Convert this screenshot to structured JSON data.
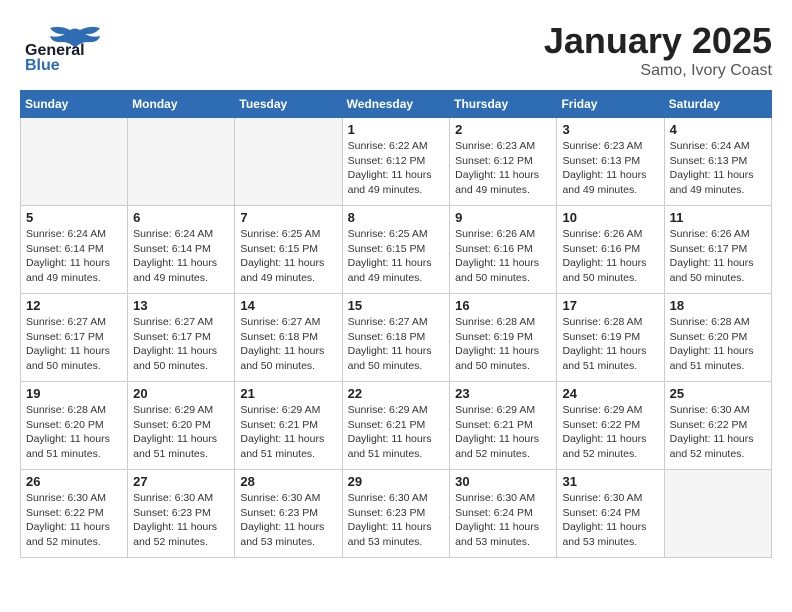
{
  "header": {
    "logo_general": "General",
    "logo_blue": "Blue",
    "month": "January 2025",
    "location": "Samo, Ivory Coast"
  },
  "days_of_week": [
    "Sunday",
    "Monday",
    "Tuesday",
    "Wednesday",
    "Thursday",
    "Friday",
    "Saturday"
  ],
  "weeks": [
    [
      {
        "day": "",
        "info": ""
      },
      {
        "day": "",
        "info": ""
      },
      {
        "day": "",
        "info": ""
      },
      {
        "day": "1",
        "info": "Sunrise: 6:22 AM\nSunset: 6:12 PM\nDaylight: 11 hours\nand 49 minutes."
      },
      {
        "day": "2",
        "info": "Sunrise: 6:23 AM\nSunset: 6:12 PM\nDaylight: 11 hours\nand 49 minutes."
      },
      {
        "day": "3",
        "info": "Sunrise: 6:23 AM\nSunset: 6:13 PM\nDaylight: 11 hours\nand 49 minutes."
      },
      {
        "day": "4",
        "info": "Sunrise: 6:24 AM\nSunset: 6:13 PM\nDaylight: 11 hours\nand 49 minutes."
      }
    ],
    [
      {
        "day": "5",
        "info": "Sunrise: 6:24 AM\nSunset: 6:14 PM\nDaylight: 11 hours\nand 49 minutes."
      },
      {
        "day": "6",
        "info": "Sunrise: 6:24 AM\nSunset: 6:14 PM\nDaylight: 11 hours\nand 49 minutes."
      },
      {
        "day": "7",
        "info": "Sunrise: 6:25 AM\nSunset: 6:15 PM\nDaylight: 11 hours\nand 49 minutes."
      },
      {
        "day": "8",
        "info": "Sunrise: 6:25 AM\nSunset: 6:15 PM\nDaylight: 11 hours\nand 49 minutes."
      },
      {
        "day": "9",
        "info": "Sunrise: 6:26 AM\nSunset: 6:16 PM\nDaylight: 11 hours\nand 50 minutes."
      },
      {
        "day": "10",
        "info": "Sunrise: 6:26 AM\nSunset: 6:16 PM\nDaylight: 11 hours\nand 50 minutes."
      },
      {
        "day": "11",
        "info": "Sunrise: 6:26 AM\nSunset: 6:17 PM\nDaylight: 11 hours\nand 50 minutes."
      }
    ],
    [
      {
        "day": "12",
        "info": "Sunrise: 6:27 AM\nSunset: 6:17 PM\nDaylight: 11 hours\nand 50 minutes."
      },
      {
        "day": "13",
        "info": "Sunrise: 6:27 AM\nSunset: 6:17 PM\nDaylight: 11 hours\nand 50 minutes."
      },
      {
        "day": "14",
        "info": "Sunrise: 6:27 AM\nSunset: 6:18 PM\nDaylight: 11 hours\nand 50 minutes."
      },
      {
        "day": "15",
        "info": "Sunrise: 6:27 AM\nSunset: 6:18 PM\nDaylight: 11 hours\nand 50 minutes."
      },
      {
        "day": "16",
        "info": "Sunrise: 6:28 AM\nSunset: 6:19 PM\nDaylight: 11 hours\nand 50 minutes."
      },
      {
        "day": "17",
        "info": "Sunrise: 6:28 AM\nSunset: 6:19 PM\nDaylight: 11 hours\nand 51 minutes."
      },
      {
        "day": "18",
        "info": "Sunrise: 6:28 AM\nSunset: 6:20 PM\nDaylight: 11 hours\nand 51 minutes."
      }
    ],
    [
      {
        "day": "19",
        "info": "Sunrise: 6:28 AM\nSunset: 6:20 PM\nDaylight: 11 hours\nand 51 minutes."
      },
      {
        "day": "20",
        "info": "Sunrise: 6:29 AM\nSunset: 6:20 PM\nDaylight: 11 hours\nand 51 minutes."
      },
      {
        "day": "21",
        "info": "Sunrise: 6:29 AM\nSunset: 6:21 PM\nDaylight: 11 hours\nand 51 minutes."
      },
      {
        "day": "22",
        "info": "Sunrise: 6:29 AM\nSunset: 6:21 PM\nDaylight: 11 hours\nand 51 minutes."
      },
      {
        "day": "23",
        "info": "Sunrise: 6:29 AM\nSunset: 6:21 PM\nDaylight: 11 hours\nand 52 minutes."
      },
      {
        "day": "24",
        "info": "Sunrise: 6:29 AM\nSunset: 6:22 PM\nDaylight: 11 hours\nand 52 minutes."
      },
      {
        "day": "25",
        "info": "Sunrise: 6:30 AM\nSunset: 6:22 PM\nDaylight: 11 hours\nand 52 minutes."
      }
    ],
    [
      {
        "day": "26",
        "info": "Sunrise: 6:30 AM\nSunset: 6:22 PM\nDaylight: 11 hours\nand 52 minutes."
      },
      {
        "day": "27",
        "info": "Sunrise: 6:30 AM\nSunset: 6:23 PM\nDaylight: 11 hours\nand 52 minutes."
      },
      {
        "day": "28",
        "info": "Sunrise: 6:30 AM\nSunset: 6:23 PM\nDaylight: 11 hours\nand 53 minutes."
      },
      {
        "day": "29",
        "info": "Sunrise: 6:30 AM\nSunset: 6:23 PM\nDaylight: 11 hours\nand 53 minutes."
      },
      {
        "day": "30",
        "info": "Sunrise: 6:30 AM\nSunset: 6:24 PM\nDaylight: 11 hours\nand 53 minutes."
      },
      {
        "day": "31",
        "info": "Sunrise: 6:30 AM\nSunset: 6:24 PM\nDaylight: 11 hours\nand 53 minutes."
      },
      {
        "day": "",
        "info": ""
      }
    ]
  ]
}
